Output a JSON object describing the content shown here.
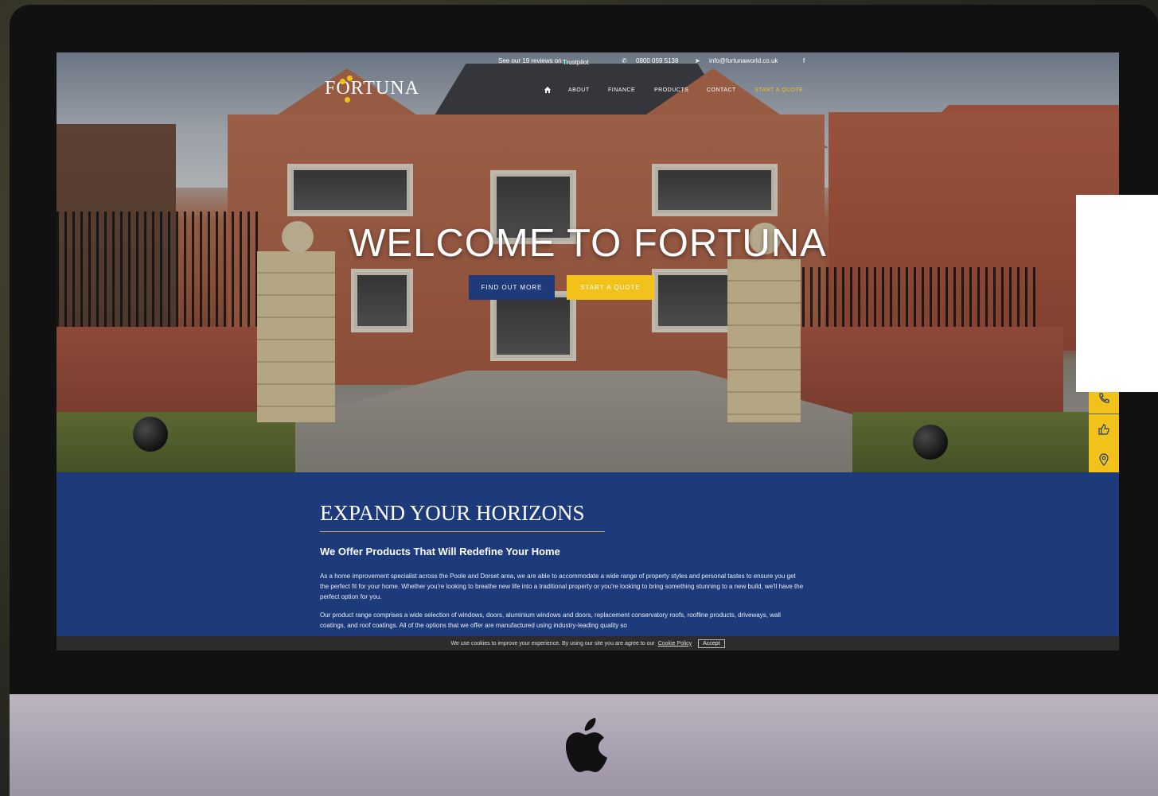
{
  "topbar": {
    "reviews_text": "See our 19 reviews on",
    "trustpilot": "Trustpilot",
    "phone": "0800 059 5138",
    "email": "info@fortunaworld.co.uk"
  },
  "brand": {
    "logo_text": "FORTUNA"
  },
  "nav": {
    "items": [
      "ABOUT",
      "FINANCE",
      "PRODUCTS",
      "CONTACT"
    ],
    "quote": "START A QUOTE"
  },
  "hero": {
    "title": "WELCOME TO FORTUNA",
    "find_out_more": "FIND OUT MORE",
    "start_quote": "START A QUOTE"
  },
  "content": {
    "heading": "EXPAND YOUR HORIZONS",
    "subheading": "We Offer Products That Will Redefine Your Home",
    "paragraph1": "As a home improvement specialist across the Poole and Dorset area, we are able to accommodate a wide range of property styles and personal tastes to ensure you get the perfect fit for your home. Whether you're looking to breathe new life into a traditional property or you're looking to bring something stunning to a new build, we'll have the perfect option for you.",
    "paragraph2": "Our product range comprises a wide selection of windows, doors, aluminium windows and doors, replacement conservatory roofs, roofline products, driveways, wall coatings, and roof coatings. All of the options that we offer are manufactured using industry-leading quality so"
  },
  "cookie": {
    "text": "We use cookies to improve your experience. By using our site you are agree to our",
    "link": "Cookie Policy",
    "accept": "Accept"
  },
  "side_tabs": [
    "phone-icon",
    "thumbs-up-icon",
    "map-pin-icon"
  ],
  "colors": {
    "brand_blue": "#1d3b7a",
    "accent_yellow": "#f2c21b"
  }
}
